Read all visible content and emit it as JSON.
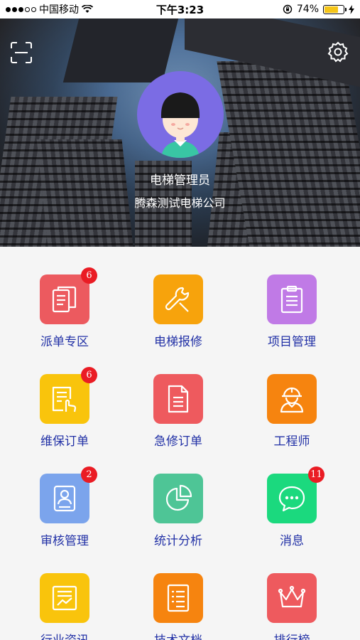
{
  "status_bar": {
    "carrier": "中国移动",
    "time": "下午3:23",
    "battery_percent": "74%",
    "battery_level": 0.74
  },
  "header": {
    "user_name": "电梯管理员",
    "company": "腾森测试电梯公司",
    "avatar_color": "#7b6ce4"
  },
  "menu": [
    {
      "label": "派单专区",
      "badge": "6",
      "color": "#ec5a5f",
      "icon": "documents-icon"
    },
    {
      "label": "电梯报修",
      "badge": "",
      "color": "#f7a30c",
      "icon": "wrench-icon"
    },
    {
      "label": "项目管理",
      "badge": "",
      "color": "#c07ae6",
      "icon": "clipboard-icon"
    },
    {
      "label": "维保订单",
      "badge": "6",
      "color": "#f9c40c",
      "icon": "hand-form-icon"
    },
    {
      "label": "急修订单",
      "badge": "",
      "color": "#ee5a5e",
      "icon": "document-icon"
    },
    {
      "label": "工程师",
      "badge": "",
      "color": "#f6840f",
      "icon": "engineer-icon"
    },
    {
      "label": "审核管理",
      "badge": "2",
      "color": "#7ba4ec",
      "icon": "id-card-icon"
    },
    {
      "label": "统计分析",
      "badge": "",
      "color": "#4ec596",
      "icon": "pie-chart-icon"
    },
    {
      "label": "消息",
      "badge": "11",
      "color": "#1bd97e",
      "icon": "chat-icon"
    },
    {
      "label": "行业资讯",
      "badge": "",
      "color": "#f9c40c",
      "icon": "news-icon"
    },
    {
      "label": "技术文档",
      "badge": "",
      "color": "#f6840f",
      "icon": "list-doc-icon"
    },
    {
      "label": "排行榜",
      "badge": "",
      "color": "#ee5a5e",
      "icon": "crown-icon"
    }
  ]
}
